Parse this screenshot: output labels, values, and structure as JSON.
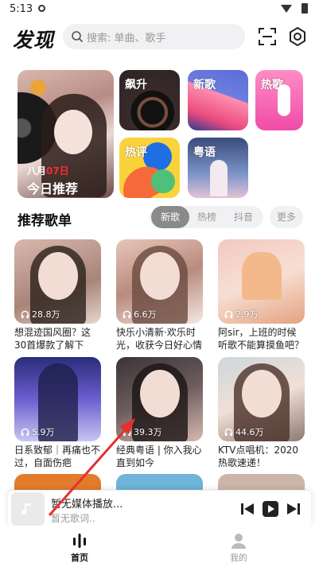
{
  "status_bar": {
    "time": "5:13"
  },
  "header": {
    "title": "发现",
    "search_placeholder": "搜索: 单曲、歌手"
  },
  "daily": {
    "month": "八月",
    "day": "07日",
    "title": "今日推荐"
  },
  "tiles": [
    {
      "label": "飙升"
    },
    {
      "label": "新歌"
    },
    {
      "label": "热歌"
    },
    {
      "label": "热评"
    },
    {
      "label": "粤语"
    }
  ],
  "section": {
    "title": "推荐歌单",
    "tabs": [
      "新歌",
      "热榜",
      "抖音"
    ],
    "active_tab": "新歌",
    "more": "更多"
  },
  "playlists": [
    {
      "plays": "28.8万",
      "name": "想混迹国风圈？这30首爆款了解下"
    },
    {
      "plays": "6.6万",
      "name": "快乐小清新·欢乐时光，收获今日好心情"
    },
    {
      "plays": "2.9万",
      "name": "阿sir，上班的时候听歌不能算摸鱼吧？"
    },
    {
      "plays": "5.9万",
      "name": "日系致郁｜再痛也不过，自面伤疤"
    },
    {
      "plays": "39.3万",
      "name": "经典粤语 | 你入我心 直到如今"
    },
    {
      "plays": "44.6万",
      "name": "KTV点唱机：2020热歌速递！"
    }
  ],
  "player": {
    "title": "暂无媒体播放...",
    "lyric": "暂无歌词.."
  },
  "nav": {
    "home": "首页",
    "me": "我的"
  },
  "colors": {
    "accent_red": "#ff2a2a",
    "annotation_arrow": "#e53030"
  }
}
